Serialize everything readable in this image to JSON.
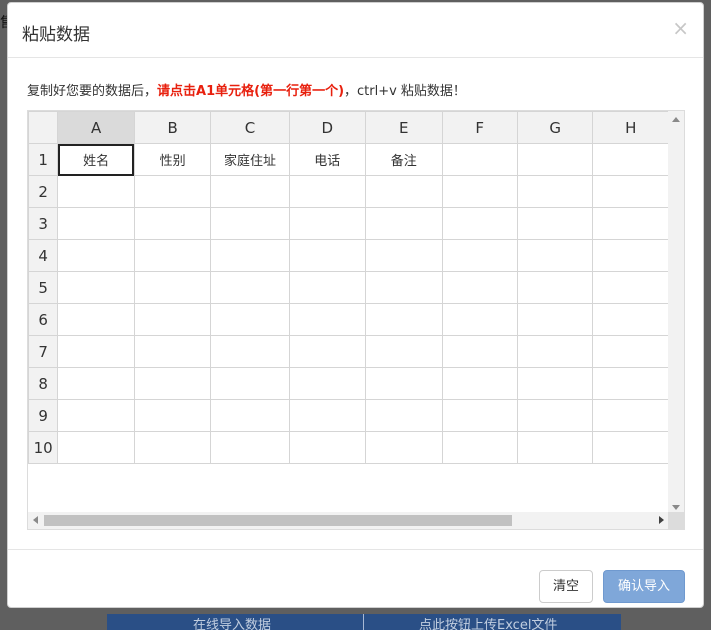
{
  "background": {
    "left_glyph": "售",
    "bar_left_text": "在线导入数据",
    "bar_right_text": "点此按钮上传Excel文件"
  },
  "modal": {
    "title": "粘贴数据",
    "close_symbol": "×",
    "hint": {
      "prefix": "复制好您要的数据后，",
      "emphasis": "请点击A1单元格(第一行第一个)",
      "suffix": "，ctrl+v 粘贴数据！"
    }
  },
  "sheet": {
    "columns": [
      "A",
      "B",
      "C",
      "D",
      "E",
      "F",
      "G",
      "H"
    ],
    "selected_column": "A",
    "rows": [
      [
        "1",
        "姓名",
        "性别",
        "家庭住址",
        "电话",
        "备注",
        "",
        "",
        ""
      ],
      [
        "2",
        "",
        "",
        "",
        "",
        "",
        "",
        "",
        ""
      ],
      [
        "3",
        "",
        "",
        "",
        "",
        "",
        "",
        "",
        ""
      ],
      [
        "4",
        "",
        "",
        "",
        "",
        "",
        "",
        "",
        ""
      ],
      [
        "5",
        "",
        "",
        "",
        "",
        "",
        "",
        "",
        ""
      ],
      [
        "6",
        "",
        "",
        "",
        "",
        "",
        "",
        "",
        ""
      ],
      [
        "7",
        "",
        "",
        "",
        "",
        "",
        "",
        "",
        ""
      ],
      [
        "8",
        "",
        "",
        "",
        "",
        "",
        "",
        "",
        ""
      ],
      [
        "9",
        "",
        "",
        "",
        "",
        "",
        "",
        "",
        ""
      ],
      [
        "10",
        "",
        "",
        "",
        "",
        "",
        "",
        "",
        ""
      ]
    ],
    "active_cell": "A1"
  },
  "footer": {
    "clear_label": "清空",
    "confirm_label": "确认导入"
  },
  "colors": {
    "hint_emphasis": "#e8200e",
    "confirm_button": "#7fa7d9"
  }
}
